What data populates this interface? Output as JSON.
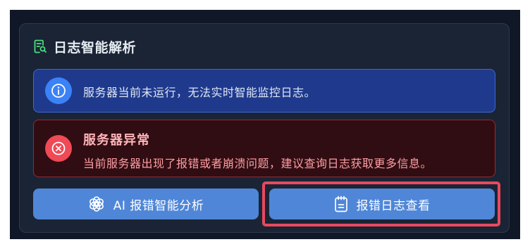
{
  "panel": {
    "title": "日志智能解析",
    "title_icon": "log-search-icon"
  },
  "info_alert": {
    "icon": "info-icon",
    "message": "服务器当前未运行，无法实时智能监控日志。"
  },
  "error_alert": {
    "icon": "error-x-icon",
    "title": "服务器异常",
    "message": "当前服务器出现了报错或者崩溃问题，建议查询日志获取更多信息。"
  },
  "actions": {
    "ai_label": "AI 报错智能分析",
    "ai_icon": "ai-knot-icon",
    "log_label": "报错日志查看",
    "log_icon": "notepad-icon"
  },
  "colors": {
    "background": "#101726",
    "card": "#1b2434",
    "info_bg": "#1f3a8c",
    "error_bg": "#300d12",
    "button": "#4f86d8",
    "highlight": "#e8495f",
    "title_icon": "#4ade80"
  }
}
